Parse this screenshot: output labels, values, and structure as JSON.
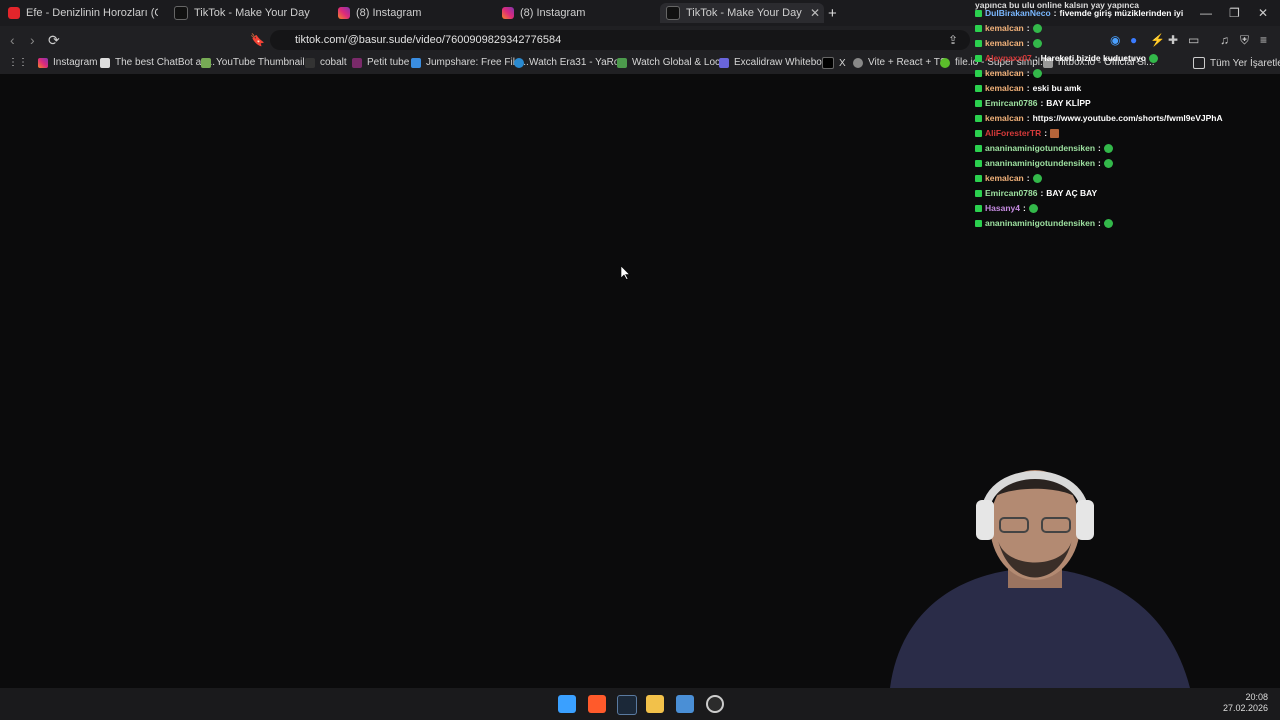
{
  "tabs": [
    {
      "title": "Efe - Denizlinin Horozları (Offical Vidé",
      "icon": "youtube-icon"
    },
    {
      "title": "TikTok - Make Your Day",
      "icon": "tiktok-icon"
    },
    {
      "title": "(8) Instagram",
      "icon": "instagram-icon"
    },
    {
      "title": "(8) Instagram",
      "icon": "instagram-icon"
    },
    {
      "title": "TikTok - Make Your Day",
      "icon": "tiktok-icon",
      "active": true
    }
  ],
  "address_bar": {
    "url": "tiktok.com/@basur.sude/video/7600909829342776584"
  },
  "bookmarks": [
    "Instagram",
    "The best ChatBot an...",
    "YouTube Thumbnail...",
    "cobalt",
    "Petit tube",
    "Jumpshare: Free File...",
    "Watch Era31 - YaRo...",
    "Watch Global & Loc...",
    "Excalidraw Whitebo...",
    "X",
    "Vite + React + TS",
    "file.io - Super simpl...",
    "hitbox.io - Official Si...",
    "Tüm Yer İşaretleri"
  ],
  "chat": {
    "top_partial": "yapınca bu ulu online kalsın yay yapınca",
    "messages": [
      {
        "user": "DulBirakanNeco",
        "text": "fivemde giriş müziklerinden iyi",
        "color": "#7ab8ff"
      },
      {
        "user": "kemalcan",
        "text": "",
        "color": "#f2b27a",
        "emote": true
      },
      {
        "user": "kemalcan",
        "text": "",
        "color": "#f2b27a",
        "emote": true
      },
      {
        "user": "Aleynaxx07",
        "text": "Hareketi bizide kuduetuyo",
        "color": "#d63a3a",
        "emote": true
      },
      {
        "user": "kemalcan",
        "text": "",
        "color": "#f2b27a",
        "emote": true
      },
      {
        "user": "kemalcan",
        "text": "eski bu amk",
        "color": "#f2b27a"
      },
      {
        "user": "Emircan0786",
        "text": "BAY KLİPP",
        "color": "#9de0a0"
      },
      {
        "user": "kemalcan",
        "text": "https://www.youtube.com/shorts/fwml9eVJPhA",
        "color": "#f2b27a"
      },
      {
        "user": "AliForesterTR",
        "text": "",
        "color": "#d63a3a",
        "emote": true
      },
      {
        "user": "ananinaminigotundensiken",
        "text": "",
        "color": "#9de0a0",
        "emote": true
      },
      {
        "user": "ananinaminigotundensiken",
        "text": "",
        "color": "#9de0a0",
        "emote": true
      },
      {
        "user": "kemalcan",
        "text": "",
        "color": "#f2b27a",
        "emote": true
      },
      {
        "user": "Emircan0786",
        "text": "BAY AÇ BAY",
        "color": "#9de0a0"
      },
      {
        "user": "Hasany4",
        "text": "",
        "color": "#c58be0",
        "emote": true
      },
      {
        "user": "ananinaminigotundensiken",
        "text": "",
        "color": "#9de0a0",
        "emote": true
      }
    ]
  },
  "clock": {
    "time": "20:08",
    "date": "27.02.2026"
  }
}
